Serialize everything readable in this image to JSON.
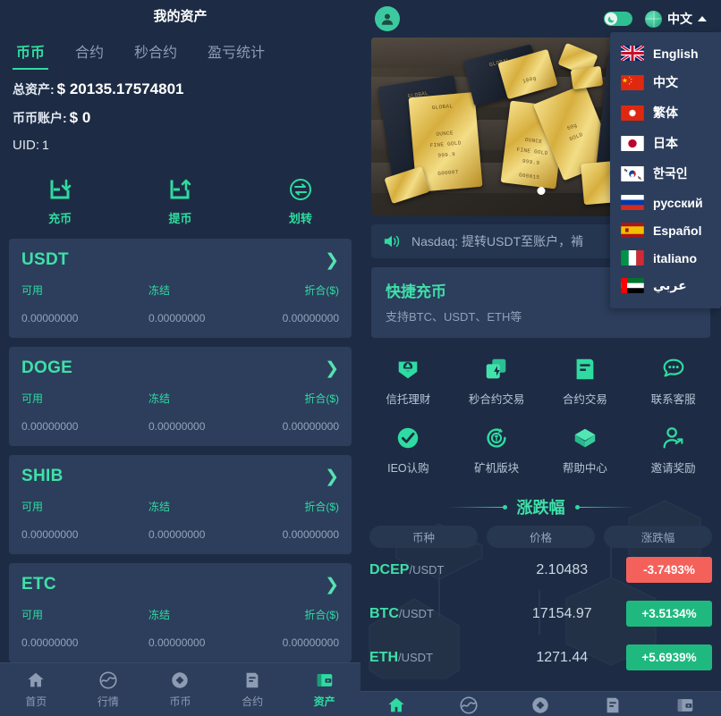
{
  "left": {
    "title": "我的资产",
    "tabs": [
      {
        "label": "币币",
        "active": true
      },
      {
        "label": "合约",
        "active": false
      },
      {
        "label": "秒合约",
        "active": false
      },
      {
        "label": "盈亏统计",
        "active": false
      }
    ],
    "stats": [
      {
        "label": "总资产:",
        "value": "$ 20135.17574801"
      },
      {
        "label": "币币账户:",
        "value": "$ 0"
      },
      {
        "label": "UID:",
        "value": "1"
      }
    ],
    "actions": [
      {
        "label": "充币",
        "icon": "deposit-icon"
      },
      {
        "label": "提币",
        "icon": "withdraw-icon"
      },
      {
        "label": "划转",
        "icon": "transfer-icon"
      }
    ],
    "coin_headers": [
      "可用",
      "冻结",
      "折合($)"
    ],
    "coins": [
      {
        "name": "USDT",
        "available": "0.00000000",
        "frozen": "0.00000000",
        "converted": "0.00000000"
      },
      {
        "name": "DOGE",
        "available": "0.00000000",
        "frozen": "0.00000000",
        "converted": "0.00000000"
      },
      {
        "name": "SHIB",
        "available": "0.00000000",
        "frozen": "0.00000000",
        "converted": "0.00000000"
      },
      {
        "name": "ETC",
        "available": "0.00000000",
        "frozen": "0.00000000",
        "converted": "0.00000000"
      }
    ],
    "bottom_nav": [
      {
        "label": "首页",
        "icon": "home-icon",
        "active": false
      },
      {
        "label": "行情",
        "icon": "market-icon",
        "active": false
      },
      {
        "label": "币币",
        "icon": "coin-icon",
        "active": false
      },
      {
        "label": "合约",
        "icon": "contract-icon",
        "active": false
      },
      {
        "label": "资产",
        "icon": "wallet-icon",
        "active": true
      }
    ]
  },
  "right": {
    "header": {
      "avatar_icon": "user-avatar-icon",
      "theme_toggle_icon": "moon-icon",
      "lang_icon": "globe-icon",
      "lang_label": "中文",
      "lang_caret_icon": "caret-up-icon"
    },
    "lang_menu": [
      {
        "label": "English",
        "flag": "uk"
      },
      {
        "label": "中文",
        "flag": "cn"
      },
      {
        "label": "繁体",
        "flag": "hk"
      },
      {
        "label": "日本",
        "flag": "jp"
      },
      {
        "label": "한국인",
        "flag": "kr"
      },
      {
        "label": "русский",
        "flag": "ru"
      },
      {
        "label": "Español",
        "flag": "es"
      },
      {
        "label": "italiano",
        "flag": "it"
      },
      {
        "label": "عربي",
        "flag": "ae"
      }
    ],
    "banner": {
      "alt": "gold-bars-banner"
    },
    "ticker": {
      "icon": "speaker-icon",
      "text": "Nasdaq: 提转USDT至账户，褃"
    },
    "quick": {
      "title": "快捷充币",
      "subtitle": "支持BTC、USDT、ETH等"
    },
    "features": [
      {
        "label": "信托理财",
        "icon": "trust-finance-icon"
      },
      {
        "label": "秒合约交易",
        "icon": "second-contract-icon"
      },
      {
        "label": "合约交易",
        "icon": "contract-trade-icon"
      },
      {
        "label": "联系客服",
        "icon": "customer-service-icon"
      },
      {
        "label": "IEO认购",
        "icon": "ieo-check-icon"
      },
      {
        "label": "矿机版块",
        "icon": "mining-icon"
      },
      {
        "label": "帮助中心",
        "icon": "help-cube-icon"
      },
      {
        "label": "邀请奖励",
        "icon": "invite-reward-icon"
      }
    ],
    "market": {
      "title": "涨跌幅",
      "columns": [
        "币种",
        "价格",
        "涨跌幅"
      ],
      "rows": [
        {
          "base": "DCEP",
          "quote": "/USDT",
          "price": "2.10483",
          "change": "-3.7493%",
          "dir": "down"
        },
        {
          "base": "BTC",
          "quote": "/USDT",
          "price": "17154.97",
          "change": "+3.5134%",
          "dir": "up"
        },
        {
          "base": "ETH",
          "quote": "/USDT",
          "price": "1271.44",
          "change": "+5.6939%",
          "dir": "up"
        }
      ]
    },
    "bottom_nav": [
      {
        "icon": "home-icon",
        "active": true
      },
      {
        "icon": "market-icon",
        "active": false
      },
      {
        "icon": "coin-icon",
        "active": false
      },
      {
        "icon": "contract-icon",
        "active": false
      },
      {
        "icon": "wallet-icon",
        "active": false
      }
    ]
  },
  "colors": {
    "bg": "#1d2c44",
    "card": "#2c3e5c",
    "accent": "#2fdba0",
    "up": "#1fb980",
    "down": "#f4615a",
    "muted": "#8d9bb3"
  }
}
